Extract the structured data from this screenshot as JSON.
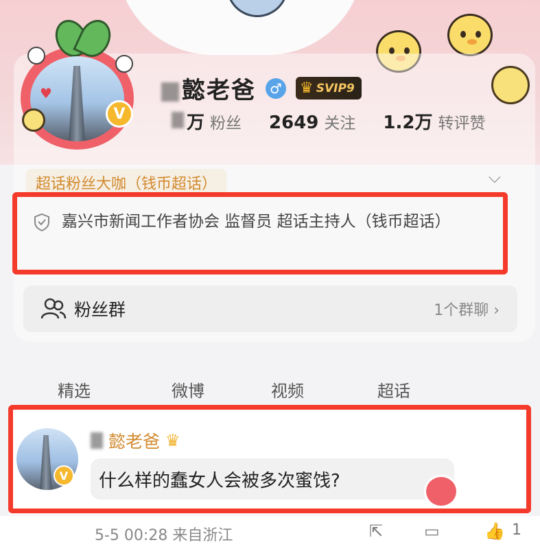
{
  "profile": {
    "name": "懿老爸",
    "vip_label": "SVIP9",
    "stats": [
      {
        "value": "万",
        "label": "粉丝"
      },
      {
        "value": "2649",
        "label": "关注"
      },
      {
        "value": "1.2万",
        "label": "转评赞"
      }
    ]
  },
  "tag": {
    "text": "超话粉丝大咖（钱币超话）"
  },
  "certification": {
    "text": "嘉兴市新闻工作者协会 监督员 超话主持人（钱币超话）"
  },
  "fans_group": {
    "label": "粉丝群",
    "right_text": "1个群聊"
  },
  "tabs": [
    "精选",
    "微博",
    "视频",
    "超话"
  ],
  "comment": {
    "author": "懿老爸",
    "text": "什么样的蠢女人会被多次蜜饯?",
    "timestamp": "5-5 00:28 来自浙江",
    "like_count": "1"
  },
  "colors": {
    "highlight": "#f43a2a",
    "accent": "#d28a2e",
    "vip_gold": "#f5c461"
  }
}
